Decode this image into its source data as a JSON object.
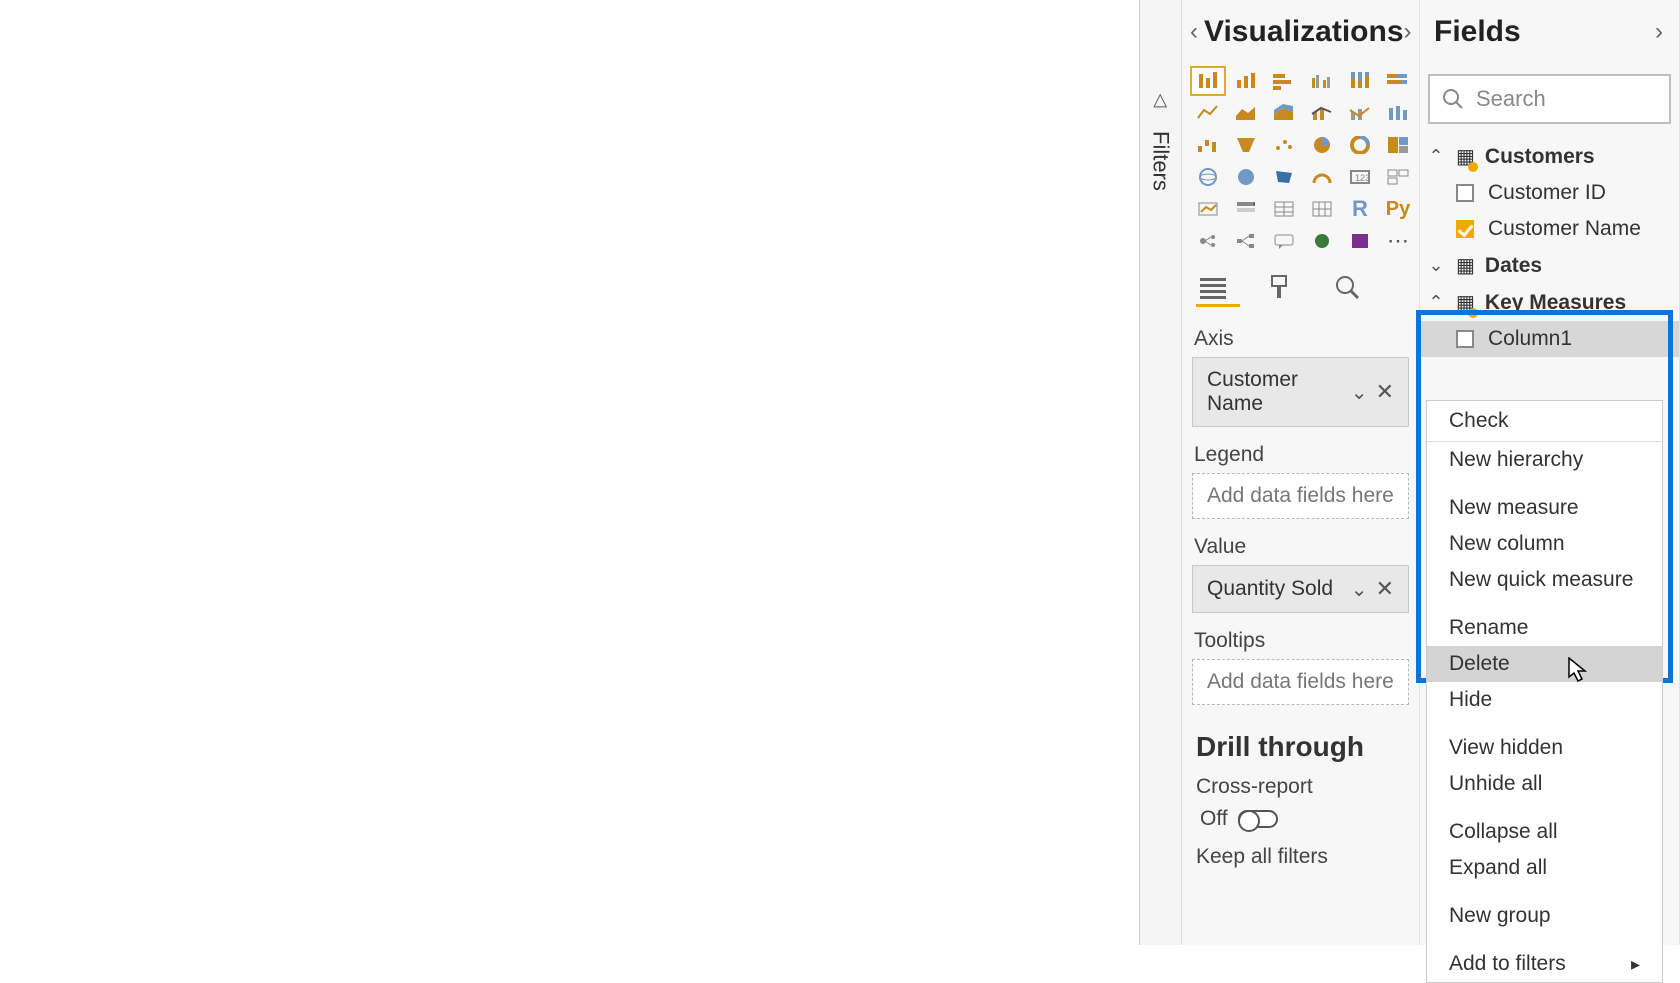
{
  "panes": {
    "filters_label": "Filters",
    "visualizations_title": "Visualizations",
    "fields_title": "Fields"
  },
  "viz_wells": {
    "axis_label": "Axis",
    "axis_field": "Customer Name",
    "legend_label": "Legend",
    "legend_placeholder": "Add data fields here",
    "value_label": "Value",
    "value_field": "Quantity Sold",
    "tooltips_label": "Tooltips",
    "tooltips_placeholder": "Add data fields here",
    "drill_title": "Drill through",
    "cross_report_label": "Cross-report",
    "toggle_off": "Off",
    "keep_all_label": "Keep all filters"
  },
  "fields": {
    "search_placeholder": "Search",
    "tables": {
      "customers": {
        "name": "Customers",
        "fields": [
          {
            "name": "Customer ID",
            "checked": false
          },
          {
            "name": "Customer Name",
            "checked": true
          }
        ]
      },
      "dates": {
        "name": "Dates"
      },
      "key_measures": {
        "name": "Key Measures",
        "fields": [
          {
            "name": "Column1",
            "checked": false
          }
        ]
      }
    }
  },
  "context_menu": {
    "items": [
      "Check",
      "New hierarchy",
      "New measure",
      "New column",
      "New quick measure",
      "Rename",
      "Delete",
      "Hide",
      "View hidden",
      "Unhide all",
      "Collapse all",
      "Expand all",
      "New group",
      "Add to filters"
    ]
  }
}
